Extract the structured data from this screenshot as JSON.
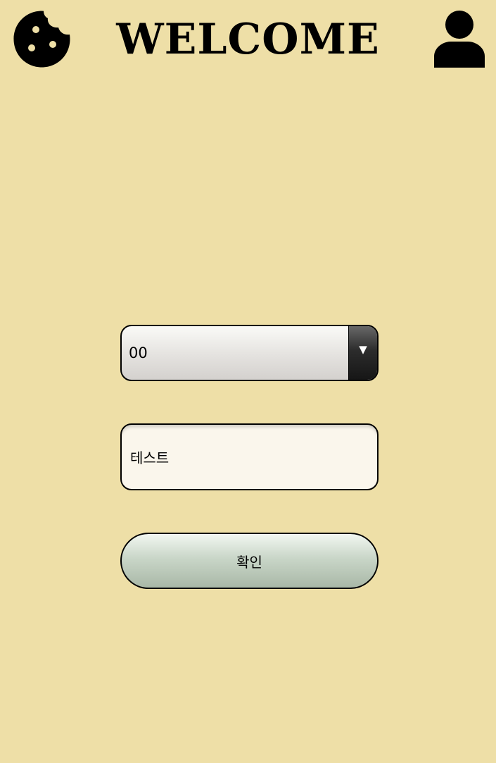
{
  "header": {
    "title": "WELCOME",
    "left_icon": "cookie-icon",
    "right_icon": "user-icon"
  },
  "form": {
    "select": {
      "value": "00"
    },
    "input": {
      "value": "테스트"
    },
    "confirm_label": "확인"
  },
  "colors": {
    "background": "#eedfa7",
    "input_background": "#faf6ec",
    "button_gradient_bottom": "#a9b8a7",
    "select_arrow": "#161616"
  }
}
